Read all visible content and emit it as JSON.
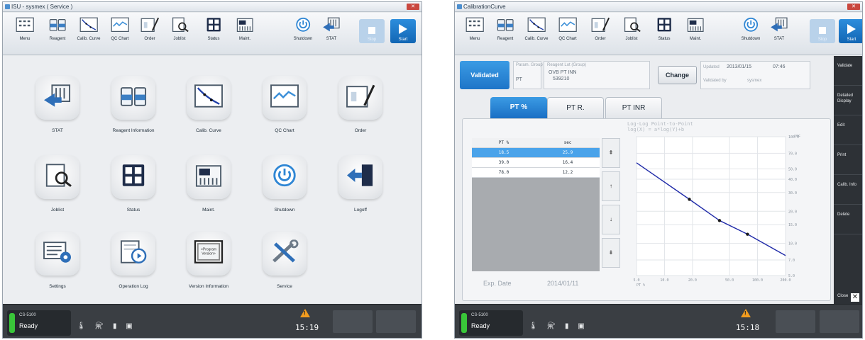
{
  "left_window": {
    "title": "ISU - sysmex ( Service )",
    "toolbar": [
      {
        "label": "Menu",
        "icon": "menu-icon"
      },
      {
        "label": "Reagent",
        "icon": "reagent-icon"
      },
      {
        "label": "Calib. Curve",
        "icon": "calib-curve-icon"
      },
      {
        "label": "QC Chart",
        "icon": "qc-chart-icon"
      },
      {
        "label": "Order",
        "icon": "order-icon"
      },
      {
        "label": "Joblist",
        "icon": "joblist-icon"
      },
      {
        "label": "Status",
        "icon": "status-icon"
      },
      {
        "label": "Maint.",
        "icon": "maint-icon"
      },
      {
        "label": "Shutdown",
        "icon": "power-icon"
      },
      {
        "label": "STAT",
        "icon": "stat-icon"
      }
    ],
    "stop_label": "Stop",
    "start_label": "Start",
    "tiles": [
      {
        "label": "STAT",
        "icon": "stat-icon"
      },
      {
        "label": "Reagent Information",
        "icon": "reagent-icon"
      },
      {
        "label": "Calib. Curve",
        "icon": "calib-curve-icon"
      },
      {
        "label": "QC Chart",
        "icon": "qc-chart-icon"
      },
      {
        "label": "Order",
        "icon": "order-icon"
      },
      {
        "label": "Joblist",
        "icon": "joblist-icon"
      },
      {
        "label": "Status",
        "icon": "status-icon"
      },
      {
        "label": "Maint.",
        "icon": "maint-icon"
      },
      {
        "label": "Shutdown",
        "icon": "power-icon"
      },
      {
        "label": "Logoff",
        "icon": "logoff-icon"
      },
      {
        "label": "Settings",
        "icon": "settings-icon"
      },
      {
        "label": "Operation Log",
        "icon": "operation-log-icon"
      },
      {
        "label": "Version Information",
        "icon": "version-icon",
        "inner_text": "<Program Version>"
      },
      {
        "label": "Service",
        "icon": "service-icon"
      }
    ],
    "status": {
      "model": "CS-5100",
      "state": "Ready",
      "time": "15:19",
      "icons": "🌡 ⚗ ▮ ▣",
      "warning": "!"
    }
  },
  "right_window": {
    "title": "CalibrationCurve",
    "toolbar": [
      {
        "label": "Menu",
        "icon": "menu-icon"
      },
      {
        "label": "Reagent",
        "icon": "reagent-icon"
      },
      {
        "label": "Calib. Curve",
        "icon": "calib-curve-icon"
      },
      {
        "label": "QC Chart",
        "icon": "qc-chart-icon"
      },
      {
        "label": "Order",
        "icon": "order-icon"
      },
      {
        "label": "Joblist",
        "icon": "joblist-icon"
      },
      {
        "label": "Status",
        "icon": "status-icon"
      },
      {
        "label": "Maint.",
        "icon": "maint-icon"
      },
      {
        "label": "Shutdown",
        "icon": "power-icon"
      },
      {
        "label": "STAT",
        "icon": "stat-icon"
      }
    ],
    "stop_label": "Stop",
    "start_label": "Start",
    "validated_label": "Validated",
    "param_group_label": "Param. Group",
    "param_group_value": "PT",
    "reagent_lot_label": "Reagent Lot (Group)",
    "reagent_name": "OVB PT INN",
    "reagent_lot": "539210",
    "change_label": "Change",
    "updated_label": "Updated",
    "updated_date": "2013/01/15",
    "updated_time": "07:46",
    "validated_by_label": "Validated by",
    "validated_by_value": "sysmex",
    "tabs": [
      "PT %",
      "PT R.",
      "PT INR"
    ],
    "table": {
      "headers": [
        "PT %",
        "sec"
      ],
      "rows": [
        [
          "18.5",
          "25.9"
        ],
        [
          "39.0",
          "16.4"
        ],
        [
          "78.0",
          "12.2"
        ]
      ]
    },
    "arrows": [
      "⇞",
      "↑",
      "↓",
      "⇟"
    ],
    "exp_date_label": "Exp. Date",
    "exp_date_value": "2014/01/11",
    "graph_title_1": "Log-Log Point-to-Point",
    "graph_title_2": "log(X) = a*log(Y)+b",
    "sidebar": [
      "Validate",
      "Detailed Display",
      "Edit",
      "Print",
      "Calib. Info",
      "Delete"
    ],
    "close_label": "Close",
    "status": {
      "model": "CS-5100",
      "state": "Ready",
      "time": "15:18",
      "icons": "🌡 ⚗ ▮ ▣",
      "warning": "!"
    }
  },
  "chart_data": {
    "type": "line",
    "title": "Log-Log Point-to-Point",
    "subtitle": "log(X) = a*log(Y)+b",
    "xlabel": "PT %",
    "ylabel": "sec",
    "x_scale": "log",
    "y_scale": "log",
    "xlim": [
      5.0,
      200.0
    ],
    "ylim": [
      5.0,
      100.0
    ],
    "x_ticks": [
      "5.0",
      "10.0",
      "20.0",
      "50.0",
      "100.0",
      "200.0"
    ],
    "y_ticks": [
      "100.0",
      "70.0",
      "50.0",
      "40.0",
      "30.0",
      "20.0",
      "15.0",
      "10.0",
      "7.0",
      "5.0"
    ],
    "grid": true,
    "line_color": "#1f2aa8",
    "series": [
      {
        "x": [
          5.0,
          18.5,
          39.0,
          78.0,
          200.0
        ],
        "y": [
          57.0,
          25.9,
          16.4,
          12.2,
          7.7
        ],
        "markers": [
          false,
          true,
          true,
          true,
          false
        ]
      }
    ]
  }
}
